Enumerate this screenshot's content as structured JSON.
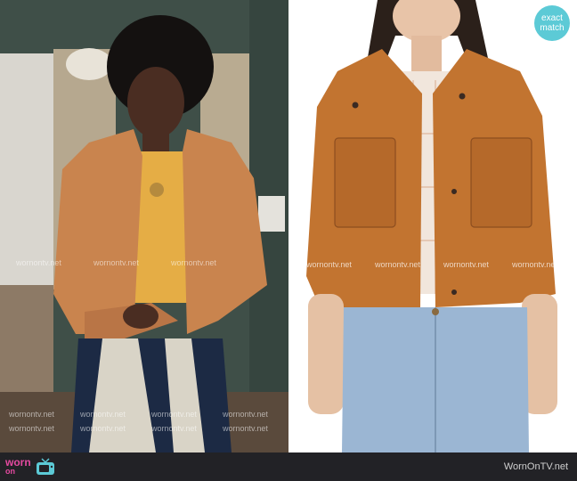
{
  "watermark": {
    "text": "wornontv.net"
  },
  "badge": {
    "line1": "exact",
    "line2": "match"
  },
  "footer": {
    "logo_worn": "worn",
    "logo_on": "on",
    "logo_tv": "tv",
    "site": "WornOnTV.net"
  },
  "colors": {
    "jacket": "#c9844e",
    "product_jacket": "#c27430",
    "badge": "#5ccad6",
    "footer": "#222226",
    "logo_pink": "#e54aa0"
  }
}
